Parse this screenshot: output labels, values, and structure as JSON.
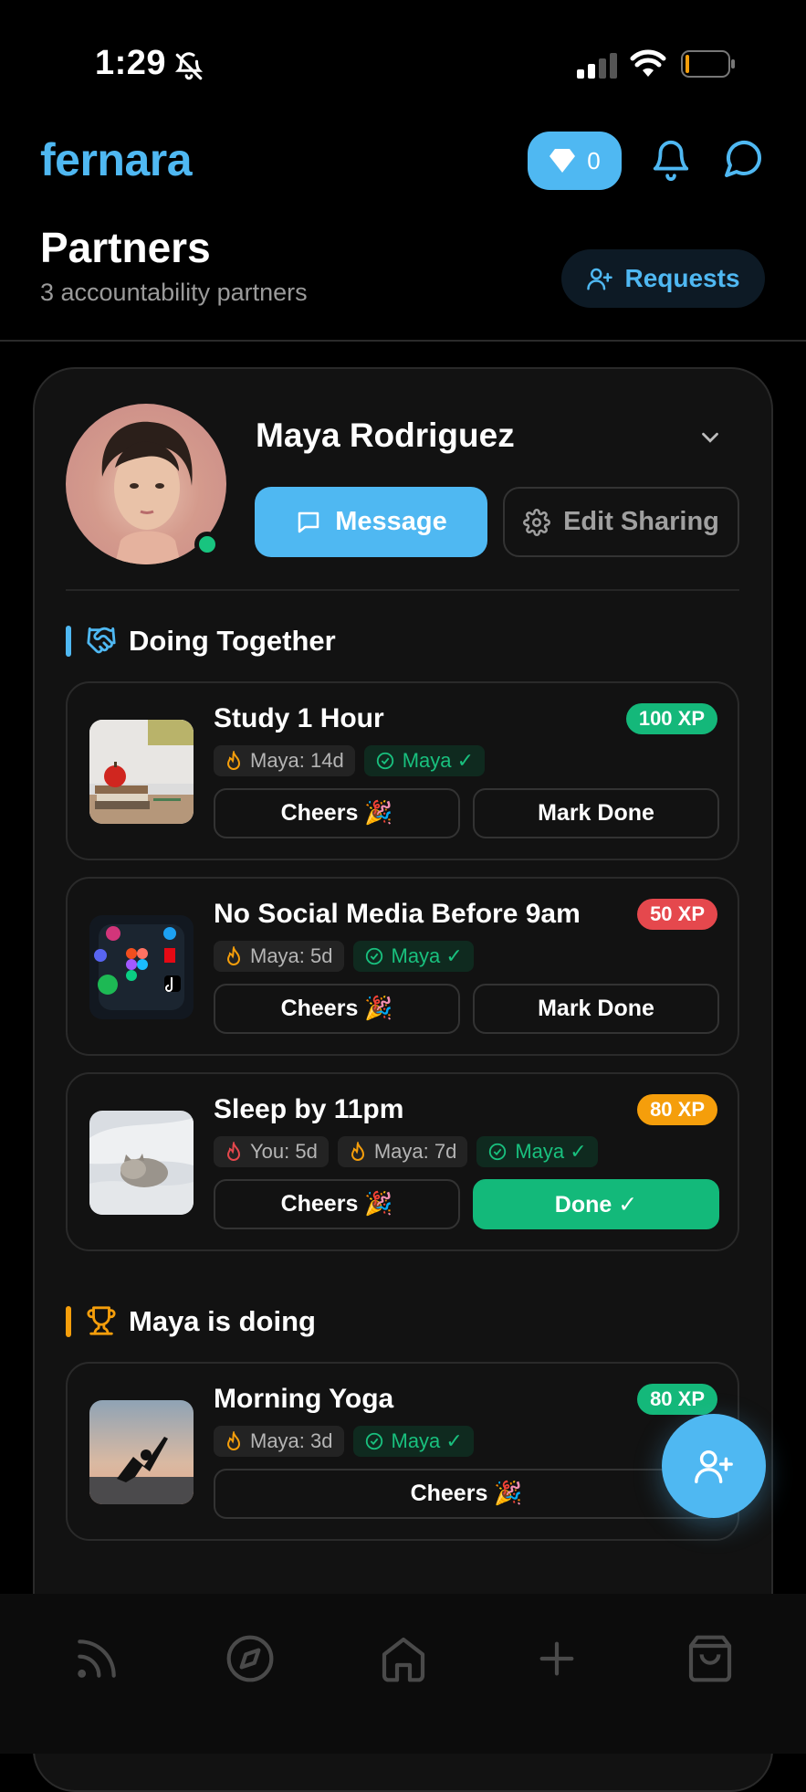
{
  "status_bar": {
    "time": "1:29"
  },
  "header": {
    "brand": "fernara",
    "gems_count": "0"
  },
  "page": {
    "title": "Partners",
    "subtitle": "3 accountability partners",
    "requests_label": "Requests"
  },
  "partner": {
    "name": "Maya Rodriguez",
    "message_label": "Message",
    "edit_sharing_label": "Edit Sharing"
  },
  "sections": {
    "together": "Doing Together",
    "partner_doing": "Maya is doing"
  },
  "habits": [
    {
      "title": "Study 1 Hour",
      "xp": "100 XP",
      "chips": [
        "Maya: 14d"
      ],
      "check": "Maya ✓",
      "cheers": "Cheers 🎉",
      "action": "Mark Done"
    },
    {
      "title": "No Social Media Before 9am",
      "xp": "50 XP",
      "chips": [
        "Maya: 5d"
      ],
      "check": "Maya ✓",
      "cheers": "Cheers 🎉",
      "action": "Mark Done"
    },
    {
      "title": "Sleep by 11pm",
      "xp": "80 XP",
      "chips": [
        "You: 5d",
        "Maya: 7d"
      ],
      "check": "Maya ✓",
      "cheers": "Cheers 🎉",
      "action": "Done ✓"
    },
    {
      "title": "Morning Yoga",
      "xp": "80 XP",
      "chips": [
        "Maya: 3d"
      ],
      "check": "Maya ✓",
      "cheers": "Cheers 🎉"
    }
  ],
  "colors": {
    "accent": "#4fb8f2",
    "xp_green": "#14b87a",
    "xp_red": "#e5484d",
    "xp_orange": "#f59e0b",
    "done_green": "#13b97a"
  },
  "nav": [
    "feed-icon",
    "compass-icon",
    "home-icon",
    "plus-icon",
    "shop-bag-icon"
  ]
}
